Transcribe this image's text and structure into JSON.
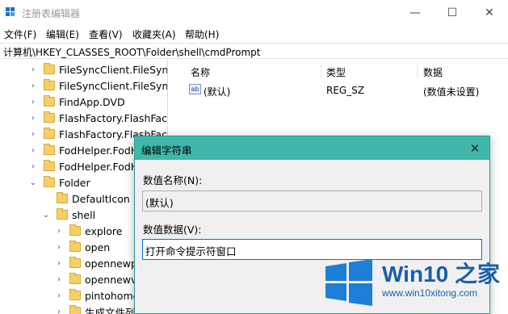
{
  "window": {
    "title": "注册表编辑器",
    "minimize": "—",
    "maximize": "☐",
    "close": "✕"
  },
  "menu": [
    "文件(F)",
    "编辑(E)",
    "查看(V)",
    "收藏夹(A)",
    "帮助(H)"
  ],
  "address": "计算机\\HKEY_CLASSES_ROOT\\Folder\\shell\\cmdPrompt",
  "tree": [
    {
      "label": "FileSyncClient.FileSyncC",
      "expander": "›"
    },
    {
      "label": "FileSyncClient.FileSyncC",
      "expander": "›"
    },
    {
      "label": "FindApp.DVD",
      "expander": "›"
    },
    {
      "label": "FlashFactory.FlashFacto",
      "expander": "›"
    },
    {
      "label": "FlashFactory.FlashFacto",
      "expander": "›"
    },
    {
      "label": "FodHelper.FodH",
      "expander": "›"
    },
    {
      "label": "FodHelper.FodH",
      "expander": "›"
    },
    {
      "label": "Folder",
      "expander": "⌄"
    },
    {
      "label": "DefaultIcon",
      "expander": ""
    },
    {
      "label": "shell",
      "expander": "⌄"
    },
    {
      "label": "explore",
      "expander": "›"
    },
    {
      "label": "open",
      "expander": "›"
    },
    {
      "label": "opennewp",
      "expander": "›"
    },
    {
      "label": "opennewv",
      "expander": "›"
    },
    {
      "label": "pintohome",
      "expander": "›"
    },
    {
      "label": "生成文件列表",
      "expander": "›"
    }
  ],
  "values": {
    "columns": [
      "名称",
      "类型",
      "数据"
    ],
    "rows": [
      {
        "icon": "ab",
        "name": "(默认)",
        "type": "REG_SZ",
        "data": "(数值未设置)"
      }
    ]
  },
  "dialog": {
    "title": "编辑字符串",
    "close": "✕",
    "name_label": "数值名称(N):",
    "name_value": "(默认)",
    "data_label": "数值数据(V):",
    "data_value": "打开命令提示符窗口"
  },
  "watermark": {
    "title": "Win10 之家",
    "url": "www.win10xitong.com"
  }
}
